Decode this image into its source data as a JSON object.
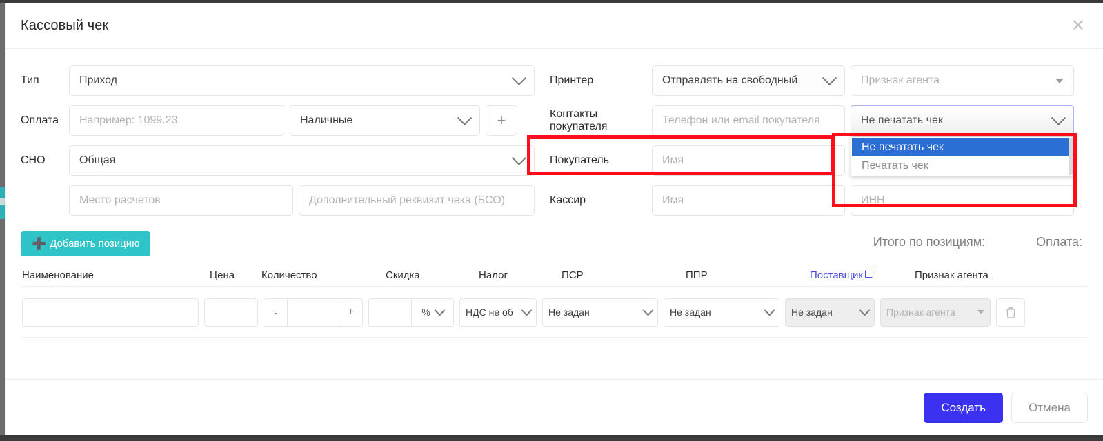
{
  "dialog": {
    "title": "Кассовый чек",
    "close_icon": "close-icon"
  },
  "form_left": {
    "type_label": "Тип",
    "type_value": "Приход",
    "payment_label": "Оплата",
    "payment_amount_placeholder": "Например: 1099.23",
    "payment_kind_value": "Наличные",
    "payment_add_label": "+",
    "sno_label": "СНО",
    "sno_value": "Общая",
    "place_placeholder": "Место расчетов",
    "extra_placeholder": "Дополнительный реквизит чека (БСО)"
  },
  "form_right": {
    "printer_label": "Принтер",
    "printer_value": "Отправлять на свободный",
    "agent_attr_placeholder": "Признак агента",
    "contacts_label": "Контакты покупателя",
    "contacts_placeholder": "Телефон или email покупателя",
    "print_select_value": "Не печатать чек",
    "print_select_options": [
      "Не печатать чек",
      "Печатать чек"
    ],
    "print_select_selected_index": 0,
    "buyer_label": "Покупатель",
    "buyer_placeholder": "Имя",
    "cashier_label": "Кассир",
    "cashier_placeholder": "Имя",
    "cashier_inn_placeholder": "ИНН"
  },
  "items": {
    "add_button_label": "Добавить позицию",
    "add_button_icon": "plus-icon",
    "totals_label": "Итого по позициям:",
    "payment_total_label": "Оплата:",
    "columns": [
      "Наименование",
      "Цена",
      "Количество",
      "Скидка",
      "Налог",
      "ПСР",
      "ППР",
      "Поставщик",
      "Признак агента"
    ],
    "supplier_link_icon": "external-link-icon",
    "row": {
      "name_value": "",
      "price_value": "",
      "qty_minus": "-",
      "qty_value": "",
      "qty_plus": "+",
      "discount_value": "",
      "discount_unit": "%",
      "tax_value": "НДС не об",
      "psr_value": "Не задан",
      "ppr_value": "Не задан",
      "supplier_value": "Не задан",
      "agent_value": "Признак агента",
      "delete_icon": "trash-icon"
    }
  },
  "footer": {
    "create_label": "Создать",
    "cancel_label": "Отмена"
  },
  "colors": {
    "primary_button": "#3b31f0",
    "add_button": "#2fc4c8",
    "link": "#4a4ae8",
    "highlight_option": "#2b6fd4",
    "annotation": "#fc0d1b"
  }
}
